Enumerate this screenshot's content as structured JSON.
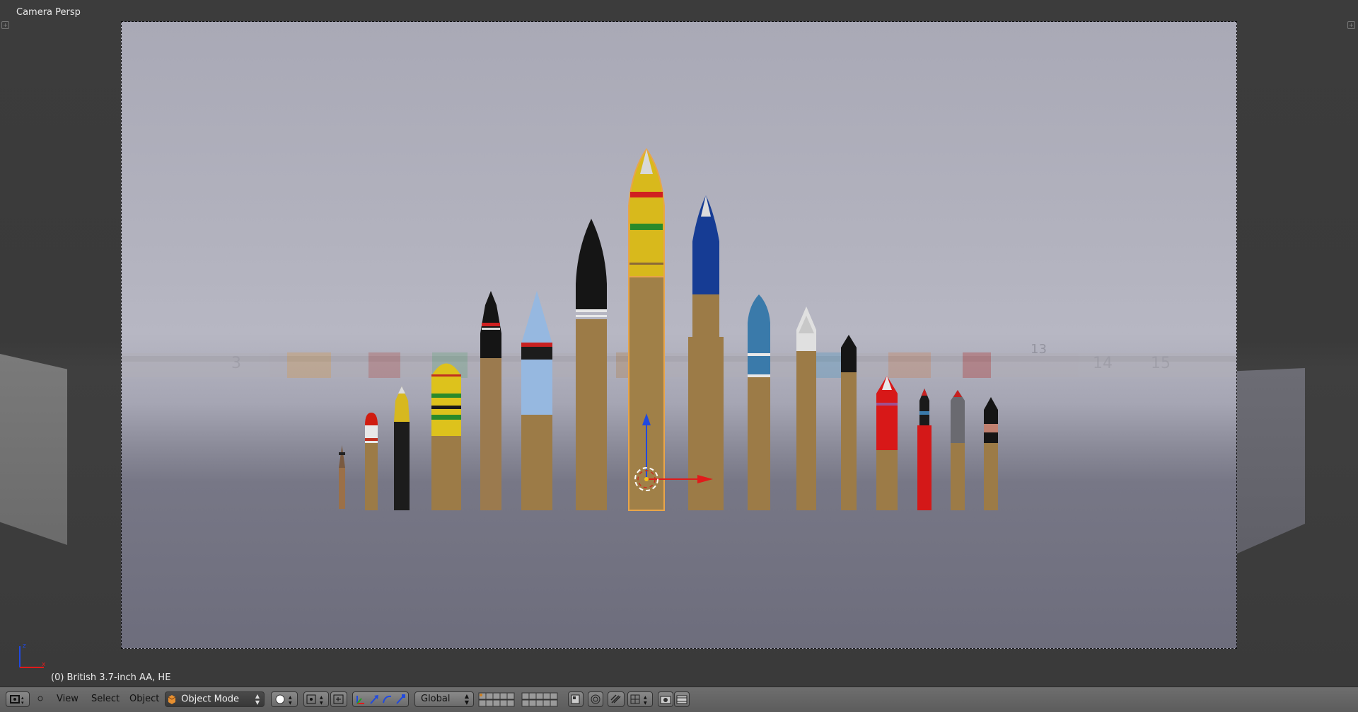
{
  "viewport": {
    "title": "Camera Persp",
    "status": "(0) British 3.7-inch AA, HE",
    "ghost_numbers": [
      "3",
      "13",
      "14",
      "15"
    ],
    "axis": {
      "z": "z",
      "x": "x"
    }
  },
  "colors": {
    "brass": "#9c7b47",
    "selection_outline": "#e8a54a",
    "axis_x": "#e01b1b",
    "axis_z": "#2049e0"
  },
  "header": {
    "menus": {
      "view": "View",
      "select": "Select",
      "object": "Object"
    },
    "mode": "Object Mode",
    "orientation": "Global",
    "icons": [
      "editor-type-icon",
      "collapse-icon",
      "mode-cube-icon",
      "shading-sphere-icon",
      "pivot-icon",
      "snap-icon",
      "manipulator-icon",
      "translate-icon",
      "rotate-icon",
      "scale-icon",
      "layers-icon",
      "lock-icon",
      "proportional-icon",
      "snapping-icon",
      "render-icon",
      "anim-render-icon"
    ]
  }
}
